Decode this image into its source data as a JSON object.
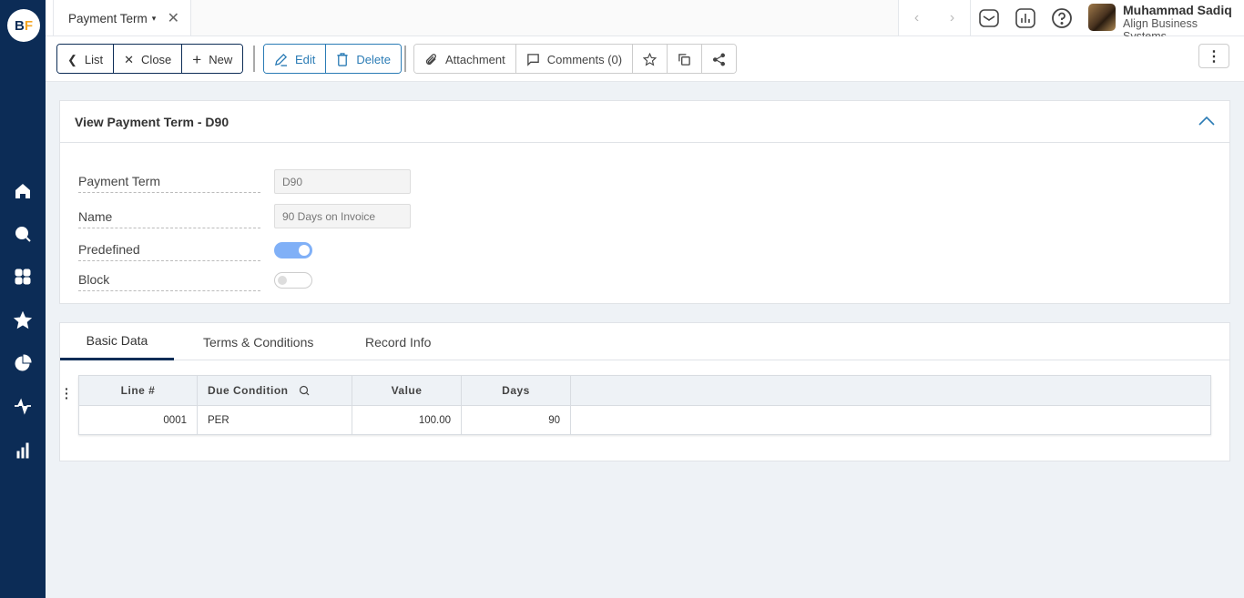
{
  "app": {
    "logo_b": "B",
    "logo_f": "F"
  },
  "tab": {
    "title": "Payment Term",
    "caret": "▾",
    "close": "✕"
  },
  "nav": {
    "prev": "‹",
    "next": "›"
  },
  "user": {
    "name": "Muhammad Sadiq",
    "org": "Align Business Systems"
  },
  "toolbar": {
    "list_label": "List",
    "close_label": "Close",
    "new_label": "New",
    "edit_label": "Edit",
    "delete_label": "Delete",
    "attachment_label": "Attachment",
    "comments_label": "Comments (0)",
    "more": "⋮"
  },
  "form": {
    "title": "View Payment Term - D90",
    "fields": [
      {
        "label": "Payment Term",
        "value": "D90"
      },
      {
        "label": "Name",
        "value": "90 Days on Invoice"
      },
      {
        "label": "Predefined",
        "toggle": true
      },
      {
        "label": "Block",
        "toggle": false
      }
    ]
  },
  "tabs": [
    "Basic Data",
    "Terms & Conditions",
    "Record Info"
  ],
  "grid": {
    "menu": "⋮",
    "columns": [
      "Line #",
      "Due Condition",
      "Value",
      "Days"
    ],
    "rows": [
      {
        "line": "0001",
        "due_condition": "PER",
        "value": "100.00",
        "days": "90"
      }
    ]
  },
  "colors": {
    "sidebar": "#0c2c56",
    "accent": "#2a7bb5",
    "toggle_on": "#80b0f7"
  }
}
